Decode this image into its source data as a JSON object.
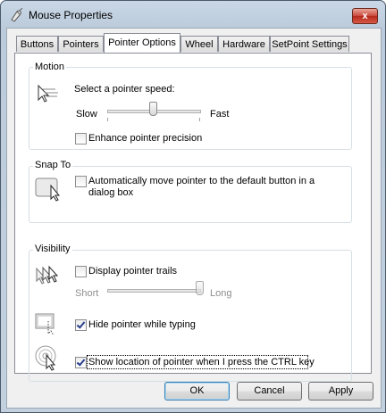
{
  "window": {
    "title": "Mouse Properties",
    "close_glyph": "x"
  },
  "tabs": [
    {
      "label": "Buttons"
    },
    {
      "label": "Pointers"
    },
    {
      "label": "Pointer Options"
    },
    {
      "label": "Wheel"
    },
    {
      "label": "Hardware"
    },
    {
      "label": "SetPoint Settings"
    }
  ],
  "active_tab": "Pointer Options",
  "motion": {
    "group_label": "Motion",
    "icon": "pointer-speed-icon",
    "speed_prompt": "Select a pointer speed:",
    "slow_label": "Slow",
    "fast_label": "Fast",
    "speed_level": 0.5,
    "precision_label": "Enhance pointer precision",
    "precision_checked": false
  },
  "snap_to": {
    "group_label": "Snap To",
    "icon": "snap-to-icon",
    "label_line1": "Automatically move pointer to the default button in a",
    "label_line2": "dialog box",
    "checked": false
  },
  "visibility": {
    "group_label": "Visibility",
    "trails_icon": "pointer-trails-icon",
    "trails_label": "Display pointer trails",
    "trails_checked": false,
    "short_label": "Short",
    "long_label": "Long",
    "trail_level": 1.0,
    "hide_icon": "hide-pointer-icon",
    "hide_label": "Hide pointer while typing",
    "hide_checked": true,
    "show_icon": "show-location-icon",
    "show_label": "Show location of pointer when I press the CTRL key",
    "show_checked": true
  },
  "buttons": {
    "ok": "OK",
    "cancel": "Cancel",
    "apply": "Apply"
  },
  "colors": {
    "close_button": "#c9473b",
    "window_frame": "#bccbdb",
    "check_mark": "#2a3f8c"
  }
}
